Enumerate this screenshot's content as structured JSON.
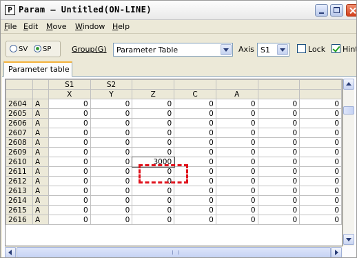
{
  "window": {
    "icon_letter": "P",
    "title": "Param – Untitled(ON-LINE)"
  },
  "menu": [
    "File",
    "Edit",
    "Move",
    "Window",
    "Help"
  ],
  "toolbar": {
    "radio_sv": "SV",
    "radio_sp": "SP",
    "selected_radio": "SP",
    "group_label": "Group(G)",
    "group_value": "Parameter Table",
    "axis_label": "Axis",
    "axis_value": "S1",
    "lock_label": "Lock",
    "lock_checked": false,
    "hint_label": "Hint",
    "hint_checked": true
  },
  "tab": {
    "label": "Parameter table"
  },
  "grid": {
    "header_row1": [
      "",
      "",
      "S1",
      "S2",
      "",
      "",
      "",
      "",
      ""
    ],
    "header_row2": [
      "",
      "",
      "X",
      "Y",
      "Z",
      "C",
      "A",
      "",
      ""
    ],
    "rows": [
      {
        "no": "2604",
        "axis": "A",
        "values": [
          "0",
          "0",
          "0",
          "0",
          "0",
          "0",
          "0"
        ]
      },
      {
        "no": "2605",
        "axis": "A",
        "values": [
          "0",
          "0",
          "0",
          "0",
          "0",
          "0",
          "0"
        ]
      },
      {
        "no": "2606",
        "axis": "A",
        "values": [
          "0",
          "0",
          "0",
          "0",
          "0",
          "0",
          "0"
        ]
      },
      {
        "no": "2607",
        "axis": "A",
        "values": [
          "0",
          "0",
          "0",
          "0",
          "0",
          "0",
          "0"
        ]
      },
      {
        "no": "2608",
        "axis": "A",
        "values": [
          "0",
          "0",
          "0",
          "0",
          "0",
          "0",
          "0"
        ]
      },
      {
        "no": "2609",
        "axis": "A",
        "values": [
          "0",
          "0",
          "0",
          "0",
          "0",
          "0",
          "0"
        ]
      },
      {
        "no": "2610",
        "axis": "A",
        "values": [
          "0",
          "0",
          "3000",
          "0",
          "0",
          "0",
          "0"
        ]
      },
      {
        "no": "2611",
        "axis": "A",
        "values": [
          "0",
          "0",
          "0",
          "0",
          "0",
          "0",
          "0"
        ]
      },
      {
        "no": "2612",
        "axis": "A",
        "values": [
          "0",
          "0",
          "0",
          "0",
          "0",
          "0",
          "0"
        ]
      },
      {
        "no": "2613",
        "axis": "A",
        "values": [
          "0",
          "0",
          "0",
          "0",
          "0",
          "0",
          "0"
        ]
      },
      {
        "no": "2614",
        "axis": "A",
        "values": [
          "0",
          "0",
          "0",
          "0",
          "0",
          "0",
          "0"
        ]
      },
      {
        "no": "2615",
        "axis": "A",
        "values": [
          "0",
          "0",
          "0",
          "0",
          "0",
          "0",
          "0"
        ]
      },
      {
        "no": "2616",
        "axis": "A",
        "values": [
          "0",
          "0",
          "0",
          "0",
          "0",
          "0",
          "0"
        ]
      }
    ],
    "editing_cell": {
      "row": "2610",
      "column": "Z",
      "value": "3000"
    }
  },
  "colors": {
    "highlight": "#e0101a",
    "tab_accent": "#f3b13b"
  }
}
